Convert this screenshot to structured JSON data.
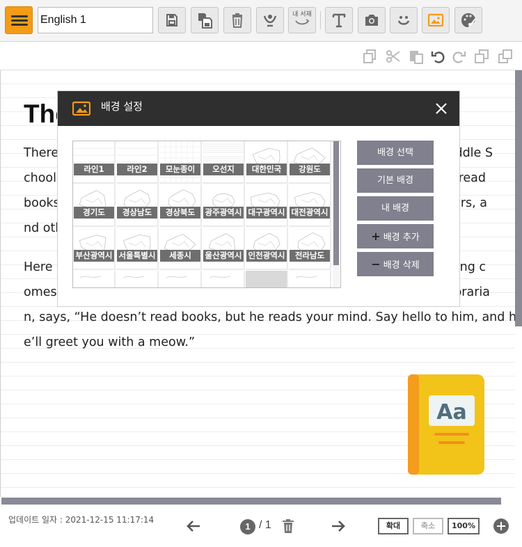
{
  "toolbar": {
    "title_value": "English 1",
    "shelf_label_line1": "내 서재",
    "accent": "#f49b17"
  },
  "document": {
    "title": "The",
    "paragraphs": [
      [
        "There",
        "ddle S"
      ],
      [
        "chool.",
        "read"
      ],
      [
        "books",
        "ers, a"
      ],
      [
        "nd oth",
        ""
      ]
    ],
    "para2_line1_left": "Here a",
    "para2_line1_right": "ng c",
    "para2_line2_left": "omes",
    "para2_line2_right": "oraria",
    "para2_line3": "n, says, “He doesn’t read books, but he reads your mind. Say hello to him, and h",
    "para2_line4": "e’ll greet you with a meow.”"
  },
  "modal": {
    "title": "배경 설정",
    "backgrounds": [
      "라인1",
      "라인2",
      "모눈종이",
      "오선지",
      "대한민국",
      "강원도",
      "경기도",
      "경상남도",
      "경상북도",
      "광주광역시",
      "대구광역시",
      "대전광역시",
      "부산광역시",
      "서울특별시",
      "세종시",
      "울산광역시",
      "인천광역시",
      "전라남도"
    ],
    "buttons": {
      "select": "배경 선택",
      "default": "기본 배경",
      "mine": "내 배경",
      "add": "배경 추가",
      "delete": "배경 삭제"
    }
  },
  "footer": {
    "updated": "업데이트 일자 : 2021-12-15 11:17:14",
    "current_page": "1",
    "total_pages": "/ 1",
    "zoom_in": "확대",
    "zoom_out": "축소",
    "zoom_level": "100%"
  }
}
